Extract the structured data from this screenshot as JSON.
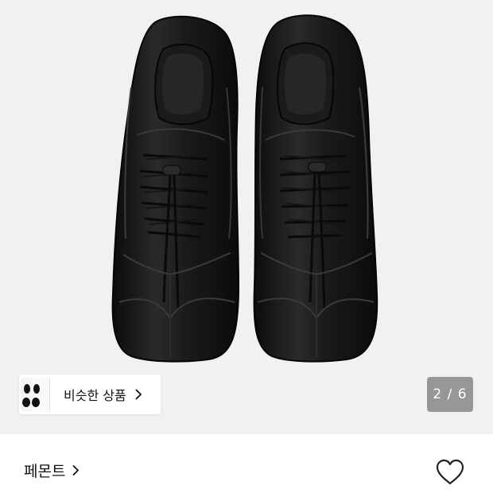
{
  "gallery": {
    "similar_label": "비슷한 상품",
    "counter": "2 / 6",
    "background_color": "#f1f1f1"
  },
  "product": {
    "brand": "페몬트"
  },
  "icons": {
    "similar_chevron": "chevron-right-icon",
    "brand_chevron": "chevron-right-icon",
    "like": "heart-outline-icon"
  }
}
